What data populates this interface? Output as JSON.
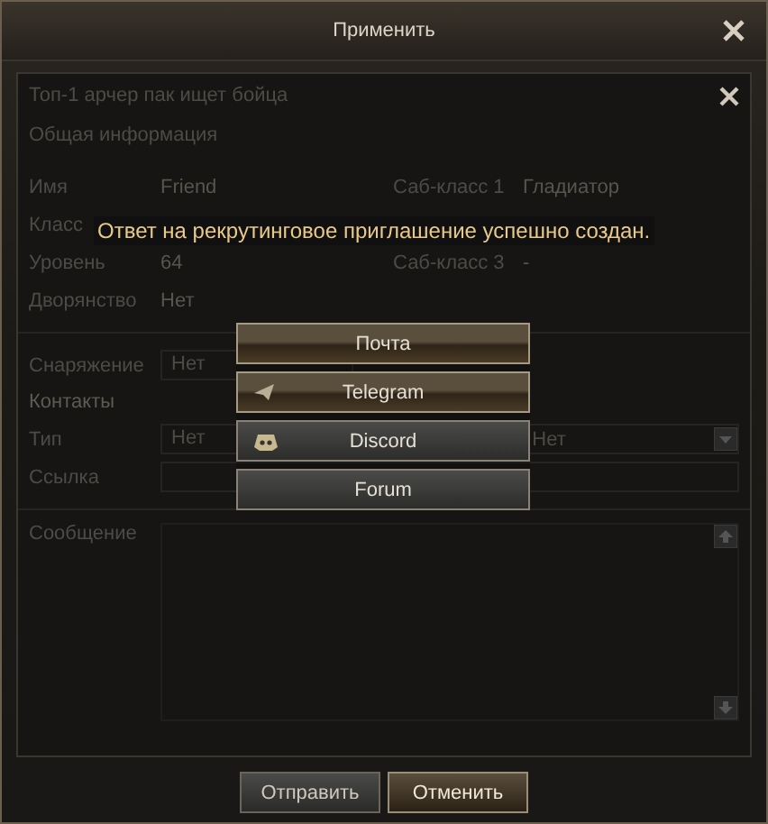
{
  "window": {
    "title": "Применить"
  },
  "panel": {
    "title": "Топ-1 арчер пак ищет бойца"
  },
  "general": {
    "heading": "Общая информация",
    "rows": [
      {
        "label": "Имя",
        "value": "Friend",
        "sub_label": "Саб-класс 1",
        "sub_value": "Гладиатор"
      },
      {
        "label": "Класс"
      },
      {
        "label": "Уровень",
        "value": "64",
        "sub_label": "Саб-класс 3",
        "sub_value": "-"
      },
      {
        "label": "Дворянство",
        "value": "Нет"
      }
    ]
  },
  "equipment": {
    "label": "Снаряжение",
    "value": "Нет"
  },
  "contacts": {
    "heading": "Контакты",
    "type_label": "Тип",
    "type_value": "Нет",
    "second_type_value": "Нет",
    "link_label": "Ссылка"
  },
  "message": {
    "label": "Сообщение"
  },
  "notice": "Ответ на рекрутинговое приглашение успешно создан.",
  "share_buttons": [
    {
      "label": "Почта",
      "kind": "mail",
      "highlighted": true
    },
    {
      "label": "Telegram",
      "kind": "telegram",
      "highlighted": true
    },
    {
      "label": "Discord",
      "kind": "discord",
      "highlighted": false
    },
    {
      "label": "Forum",
      "kind": "forum",
      "highlighted": false
    }
  ],
  "buttons": [
    {
      "label": "Отправить",
      "selected": false
    },
    {
      "label": "Отменить",
      "selected": true
    }
  ]
}
